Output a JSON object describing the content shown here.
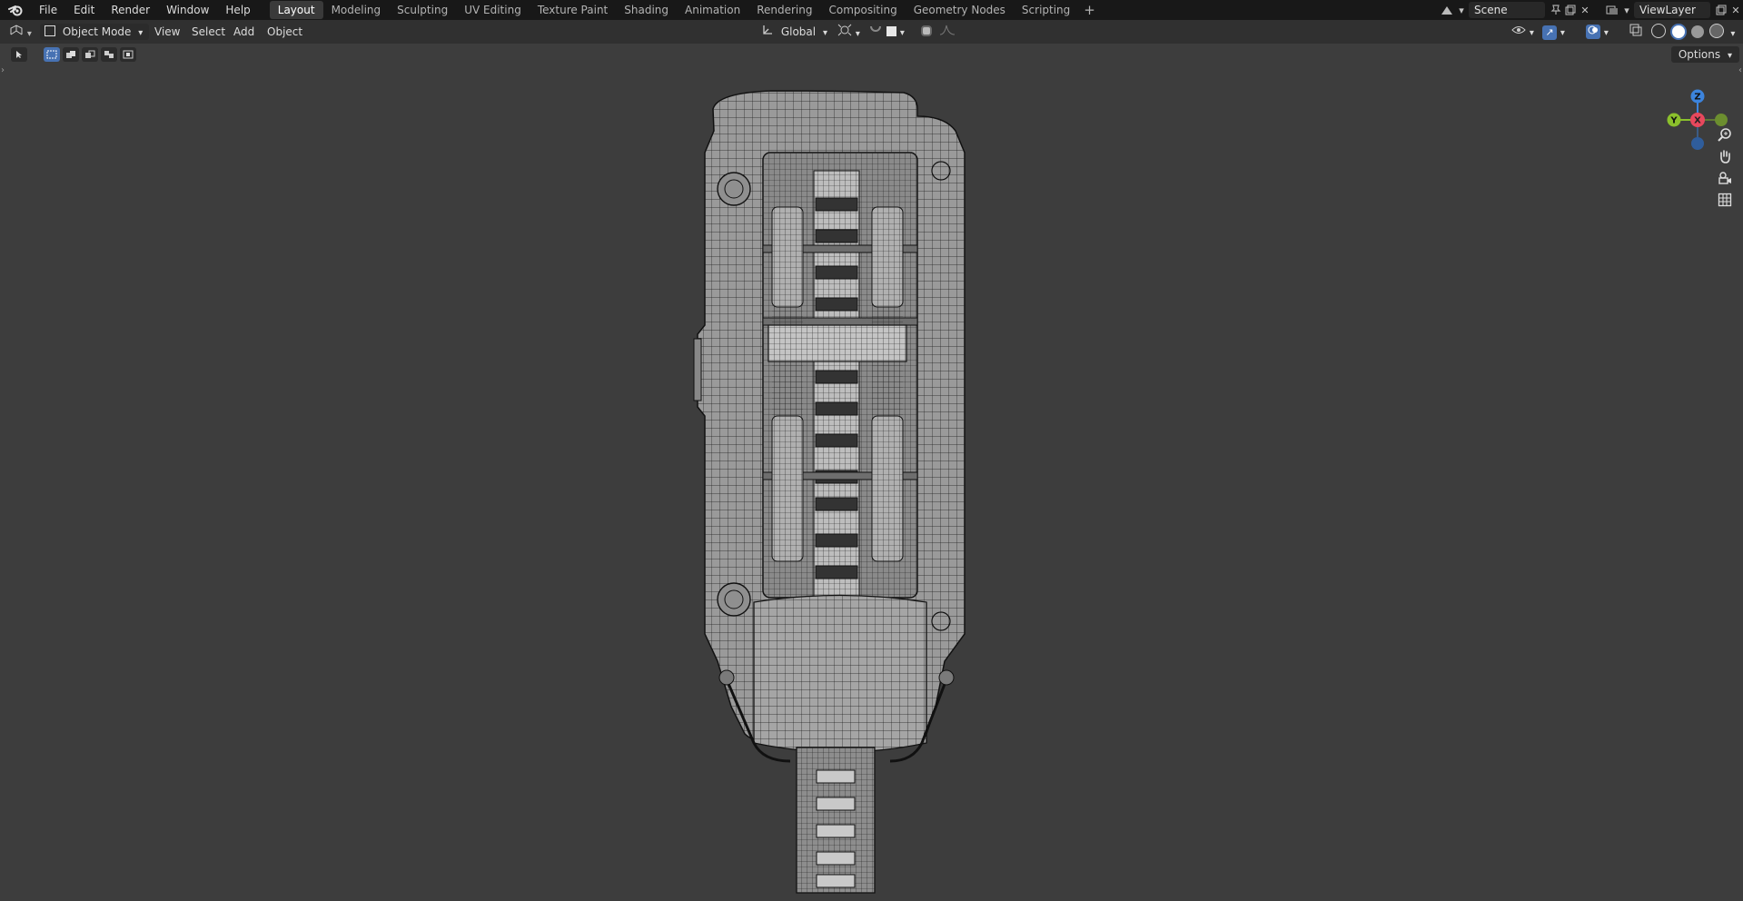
{
  "menu": {
    "items": [
      "File",
      "Edit",
      "Render",
      "Window",
      "Help"
    ]
  },
  "workspaces": {
    "tabs": [
      "Layout",
      "Modeling",
      "Sculpting",
      "UV Editing",
      "Texture Paint",
      "Shading",
      "Animation",
      "Rendering",
      "Compositing",
      "Geometry Nodes",
      "Scripting"
    ],
    "active": "Layout",
    "add_label": "+"
  },
  "scene": {
    "name": "Scene"
  },
  "view_layer": {
    "name": "ViewLayer"
  },
  "header": {
    "mode": "Object Mode",
    "view": "View",
    "select": "Select",
    "add": "Add",
    "object": "Object",
    "transform_orientation": "Global"
  },
  "viewport": {
    "options_label": "Options",
    "gizmo": {
      "z": "Z",
      "x": "X",
      "y": "Y"
    }
  },
  "colors": {
    "accent": "#4772b3",
    "axis_x": "#e8485d",
    "axis_y": "#8bc02c",
    "axis_z": "#3c84dd",
    "viewport_bg": "#3d3d3d"
  },
  "icons": [
    "blender-logo-icon",
    "editor-type-icon",
    "object-mode-icon",
    "transform-orientation-icon",
    "pivot-icon",
    "snap-icon",
    "proportional-edit-icon",
    "scene-icon",
    "pin-icon",
    "new-scene-icon",
    "close-icon",
    "view-layer-icon",
    "visibility-icon",
    "gizmo-icon",
    "overlay-icon",
    "xray-icon",
    "wireframe-shading-icon",
    "solid-shading-icon",
    "material-shading-icon",
    "rendered-shading-icon",
    "zoom-icon",
    "pan-hand-icon",
    "camera-icon",
    "grid-icon"
  ]
}
